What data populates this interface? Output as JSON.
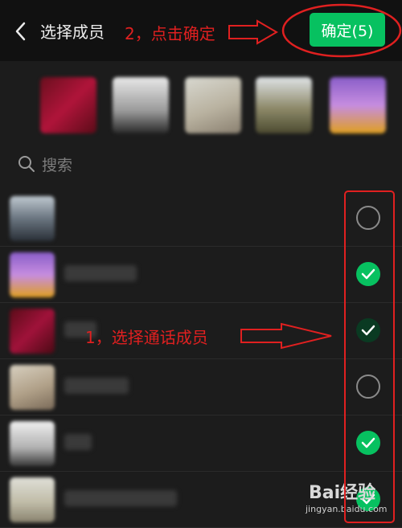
{
  "header": {
    "title": "选择成员",
    "confirm_label": "确定(5)"
  },
  "annotations": {
    "step2": "2，点击确定",
    "step1": "1，选择通话成员",
    "color": "#e02020"
  },
  "search": {
    "placeholder": "搜索"
  },
  "selected_members": [
    {
      "icon": "avatar-red"
    },
    {
      "icon": "avatar-person"
    },
    {
      "icon": "avatar-photo"
    },
    {
      "icon": "avatar-landscape"
    },
    {
      "icon": "avatar-purple"
    }
  ],
  "contacts": [
    {
      "checked": false
    },
    {
      "checked": true
    },
    {
      "checked": true
    },
    {
      "checked": false
    },
    {
      "checked": true
    },
    {
      "checked": true
    }
  ],
  "colors": {
    "accent": "#07c160",
    "background": "#1c1c1c",
    "header": "#111111"
  },
  "watermark": {
    "main": "Bai经验",
    "sub": "jingyan.baidu.com"
  }
}
